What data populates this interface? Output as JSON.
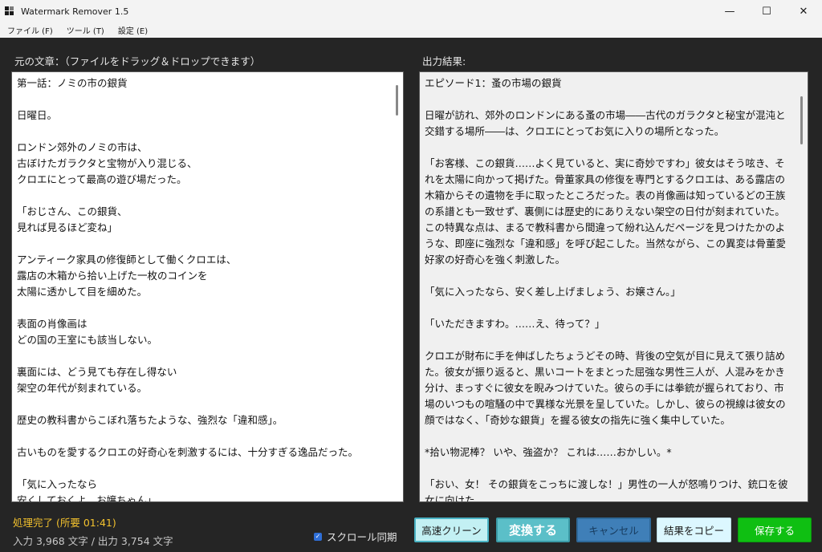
{
  "window": {
    "title": "Watermark Remover 1.5",
    "minimize_glyph": "—",
    "maximize_glyph": "☐",
    "close_glyph": "✕"
  },
  "menu": [
    "ファイル (F)",
    "ツール (T)",
    "設定 (E)"
  ],
  "left_panel": {
    "label": "元の文章：（ファイルをドラッグ＆ドロップできます）",
    "text": "第一話：ノミの市の銀貨\n\n日曜日。\n\nロンドン郊外のノミの市は、\n古ぼけたガラクタと宝物が入り混じる、\nクロエにとって最高の遊び場だった。\n\n「おじさん、この銀貨、\n見れば見るほど変ね」\n\nアンティーク家具の修復師として働くクロエは、\n露店の木箱から拾い上げた一枚のコインを\n太陽に透かして目を細めた。\n\n表面の肖像画は\nどの国の王室にも該当しない。\n\n裏面には、どう見ても存在し得ない\n架空の年代が刻まれている。\n\n歴史の教科書からこぼれ落ちたような、強烈な「違和感」。\n\n古いものを愛するクロエの好奇心を刺激するには、十分すぎる逸品だった。\n\n「気に入ったなら\n安くしておくよ、お嬢ちゃん」"
  },
  "right_panel": {
    "label": "出力結果:",
    "text": "エピソード1：蚤の市場の銀貨\n\n日曜が訪れ、郊外のロンドンにある蚤の市場――古代のガラクタと秘宝が混沌と交錯する場所――は、クロエにとってお気に入りの場所となった。\n\n「お客様、この銀貨……よく見ていると、実に奇妙ですわ」彼女はそう呟き、それを太陽に向かって掲げた。骨董家具の修復を専門とするクロエは、ある露店の木箱からその遺物を手に取ったところだった。表の肖像画は知っているどの王族の系譜とも一致せず、裏側には歴史的にありえない架空の日付が刻まれていた。この特異な点は、まるで教科書から間違って紛れ込んだページを見つけたかのような、即座に強烈な「違和感」を呼び起こした。当然ながら、この異変は骨董愛好家の好奇心を強く刺激した。\n\n「気に入ったなら、安く差し上げましょう、お嬢さん。」\n\n「いただきますわ。……え、待って？」\n\nクロエが財布に手を伸ばしたちょうどその時、背後の空気が目に見えて張り詰めた。彼女が振り返ると、黒いコートをまとった屈強な男性三人が、人混みをかき分け、まっすぐに彼女を睨みつけていた。彼らの手には拳銃が握られており、市場のいつもの喧騒の中で異様な光景を呈していた。しかし、彼らの視線は彼女の顔ではなく、「奇妙な銀貨」を握る彼女の指先に強く集中していた。\n\n*拾い物泥棒？ いや、強盗か？ これは……おかしい。*\n\n「おい、女！ その銀貨をこっちに渡しな！」男性の一人が怒鳴りつけ、銃口を彼女に向けた。"
  },
  "status": {
    "main": "処理完了 (所要 01:41)",
    "counts": "入力 3,968 文字 / 出力 3,754 文字"
  },
  "sync": {
    "label": "スクロール同期",
    "checked": true
  },
  "buttons": {
    "clean": "高速クリーン",
    "convert": "変換する",
    "cancel": "キャンセル",
    "copy": "結果をコピー",
    "save": "保存する"
  },
  "colors": {
    "background": "#252525",
    "status_accent": "#f2c12e",
    "convert": "#5bbfc8",
    "cancel": "#3f7fb8",
    "save": "#0fbf12",
    "checkbox": "#2f6fd8"
  }
}
